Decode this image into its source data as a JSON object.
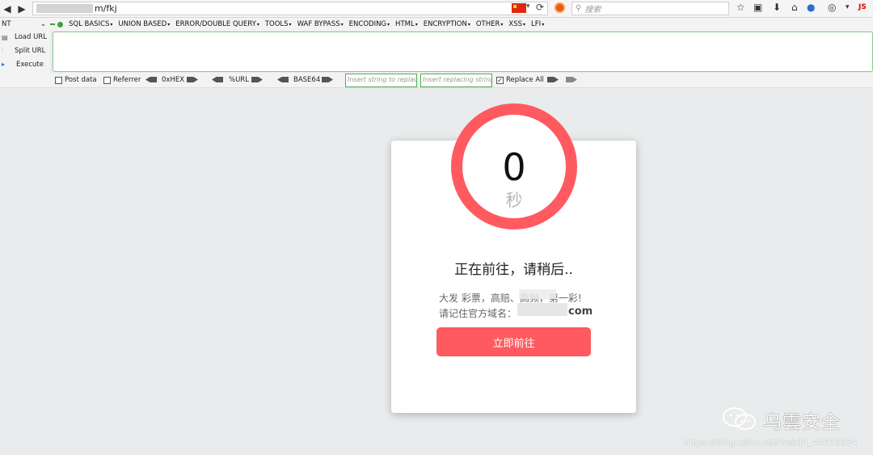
{
  "browser": {
    "url_suffix": "m/fkj",
    "search_placeholder": "搜索",
    "js_badge": "JS"
  },
  "hackbar": {
    "select_value": "NT",
    "menu": [
      "SQL BASICS",
      "UNION BASED",
      "ERROR/DOUBLE QUERY",
      "TOOLS",
      "WAF BYPASS",
      "ENCODING",
      "HTML",
      "ENCRYPTION",
      "OTHER",
      "XSS",
      "LFI"
    ],
    "actions": {
      "load": "Load URL",
      "split": "Split URL",
      "execute": "Execute"
    },
    "options": {
      "post_data": "Post data",
      "referrer": "Referrer",
      "hex": "0xHEX",
      "url": "%URL",
      "base64": "BASE64",
      "insert_placeholder": "Insert string to replace",
      "replacing_placeholder": "Insert replacing string",
      "replace_all": "Replace All"
    }
  },
  "page": {
    "countdown": "0",
    "countdown_unit": "秒",
    "heading": "正在前往，请稍后..",
    "line1": "大发 彩票，高赔、高频，第一彩!",
    "line2": "请记住官方域名：",
    "domain_suffix": "com",
    "button": "立即前往",
    "accent": "#ff5a5f"
  },
  "watermark": {
    "brand": "乌雲安全",
    "url": "https://blog.csdn.net/weixin_44678334"
  }
}
